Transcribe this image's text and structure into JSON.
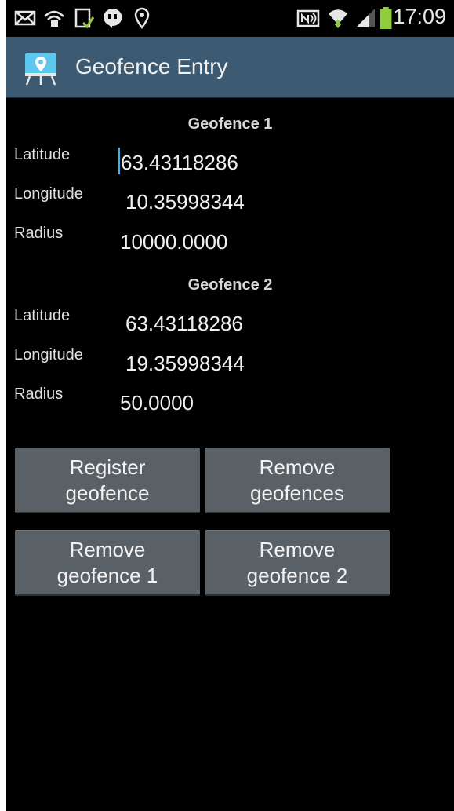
{
  "status_bar": {
    "time": "17:09",
    "left_icons": [
      "mail-icon",
      "wifi-lock-icon",
      "download-icon",
      "hangouts-icon",
      "location-pin-icon"
    ],
    "right_icons": [
      "nfc-icon",
      "wifi-icon",
      "signal-icon",
      "battery-icon"
    ]
  },
  "app": {
    "title": "Geofence Entry",
    "icon": "map-pin-board-icon"
  },
  "geofence1": {
    "title": "Geofence 1",
    "latitude_label": "Latitude",
    "latitude_value": "63.43118286",
    "longitude_label": "Longitude",
    "longitude_value": "10.35998344",
    "radius_label": "Radius",
    "radius_value": "10000.0000"
  },
  "geofence2": {
    "title": "Geofence 2",
    "latitude_label": "Latitude",
    "latitude_value": "63.43118286",
    "longitude_label": "Longitude",
    "longitude_value": "19.35998344",
    "radius_label": "Radius",
    "radius_value": "50.0000"
  },
  "buttons": {
    "register_line1": "Register",
    "register_line2": "geofence",
    "remove_all_line1": "Remove",
    "remove_all_line2": "geofences",
    "remove1_line1": "Remove",
    "remove1_line2": "geofence 1",
    "remove2_line1": "Remove",
    "remove2_line2": "geofence 2"
  },
  "colors": {
    "action_bar": "#3c5a72",
    "button": "#5a6166",
    "cursor": "#33b5e5",
    "battery": "#8fcd3c"
  }
}
